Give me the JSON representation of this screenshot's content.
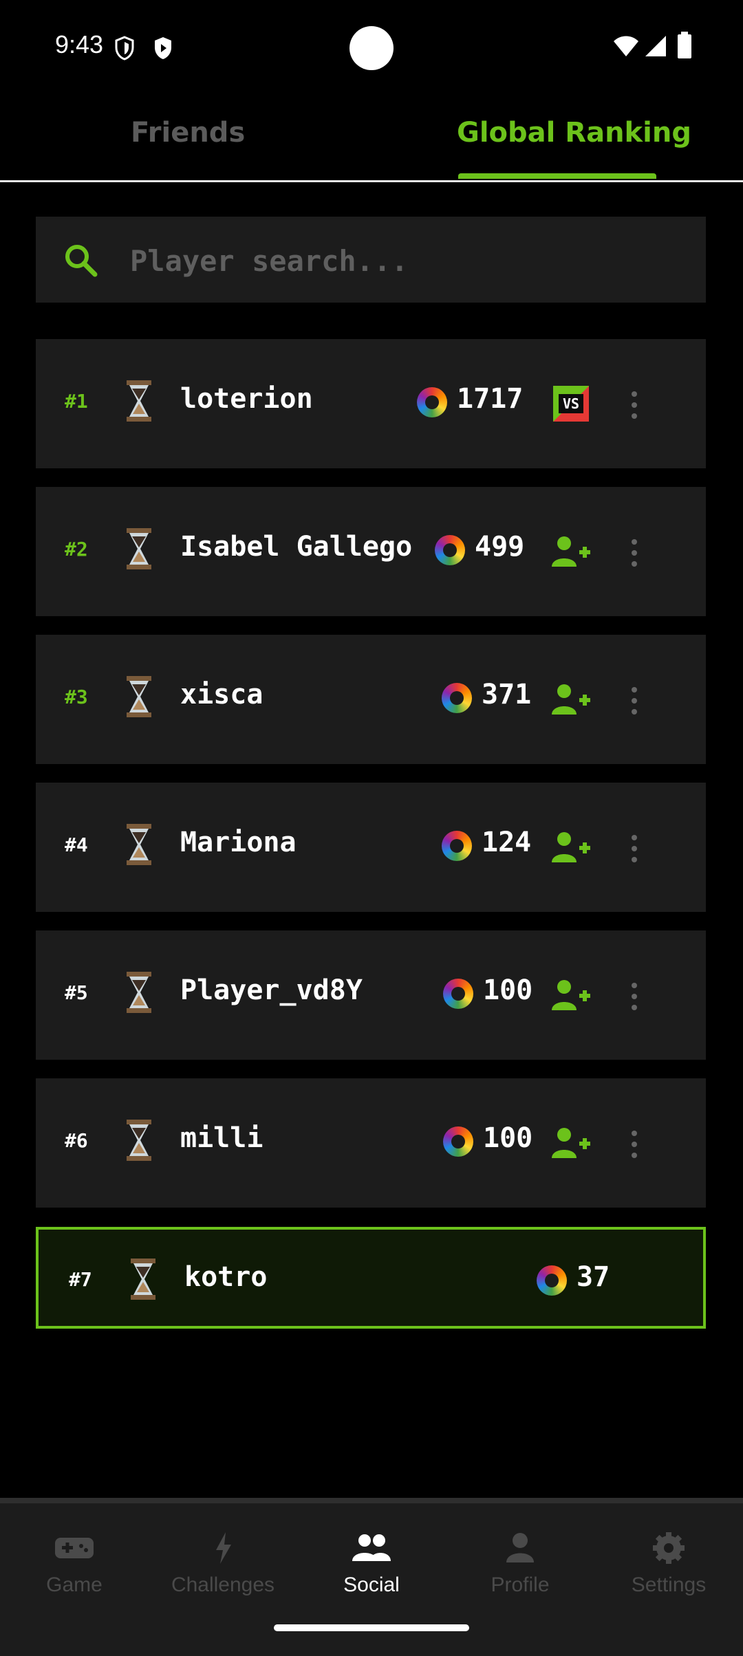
{
  "status_bar": {
    "time": "9:43"
  },
  "tabs": {
    "friends": "Friends",
    "global": "Global Ranking"
  },
  "search": {
    "placeholder": "Player search..."
  },
  "rows": [
    {
      "rank": "#1",
      "name": "loterion",
      "score": "1717",
      "action": "vs"
    },
    {
      "rank": "#2",
      "name": "Isabel Gallego",
      "score": "499",
      "action": "add-friend"
    },
    {
      "rank": "#3",
      "name": "xisca",
      "score": "371",
      "action": "add-friend"
    },
    {
      "rank": "#4",
      "name": "Mariona",
      "score": "124",
      "action": "add-friend"
    },
    {
      "rank": "#5",
      "name": "Player_vd8Y",
      "score": "100",
      "action": "add-friend"
    },
    {
      "rank": "#6",
      "name": "milli",
      "score": "100",
      "action": "add-friend"
    }
  ],
  "current_user": {
    "rank": "#7",
    "name": "kotro",
    "score": "37"
  },
  "vs_label": "VS",
  "bottom_nav": [
    {
      "label": "Game",
      "icon": "gamepad-icon"
    },
    {
      "label": "Challenges",
      "icon": "bolt-icon"
    },
    {
      "label": "Social",
      "icon": "people-icon",
      "active": true
    },
    {
      "label": "Profile",
      "icon": "person-icon"
    },
    {
      "label": "Settings",
      "icon": "gear-icon"
    }
  ],
  "colors": {
    "accent": "#6cc21b",
    "row_bg": "#1c1c1c",
    "background": "#000000"
  }
}
